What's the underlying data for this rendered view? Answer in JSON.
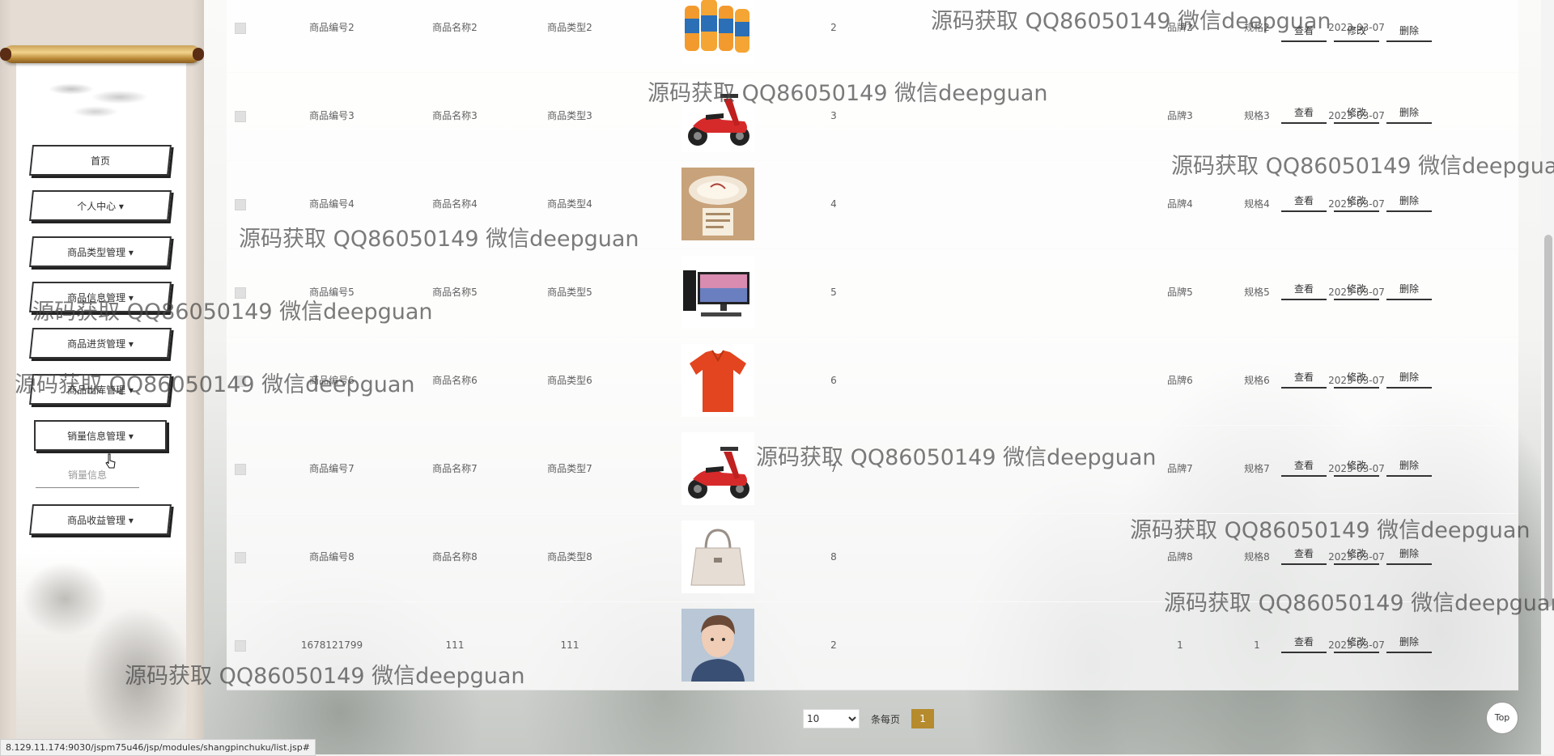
{
  "sidebar": {
    "menu": [
      {
        "label": "首页"
      },
      {
        "label": "个人中心 ▾"
      },
      {
        "label": "商品类型管理 ▾"
      },
      {
        "label": "商品信息管理 ▾"
      },
      {
        "label": "商品进货管理 ▾"
      },
      {
        "label": "商品出库管理 ▾"
      },
      {
        "label": "销量信息管理 ▾"
      },
      {
        "label": "商品收益管理 ▾"
      }
    ],
    "submenu": {
      "label": "销量信息"
    }
  },
  "table": {
    "actions": {
      "view": "查看",
      "edit": "修改",
      "delete": "删除"
    },
    "rows": [
      {
        "code": "商品编号2",
        "name": "商品名称2",
        "type": "商品类型2",
        "image": "juice-bottles",
        "qty": "2",
        "brand": "品牌2",
        "spec": "规格2",
        "date": "2023-03-07"
      },
      {
        "code": "商品编号3",
        "name": "商品名称3",
        "type": "商品类型3",
        "image": "red-scooter",
        "qty": "3",
        "brand": "品牌3",
        "spec": "规格3",
        "date": "2023-03-07"
      },
      {
        "code": "商品编号4",
        "name": "商品名称4",
        "type": "商品类型4",
        "image": "ceiling-lamp",
        "qty": "4",
        "brand": "品牌4",
        "spec": "规格4",
        "date": "2023-03-07"
      },
      {
        "code": "商品编号5",
        "name": "商品名称5",
        "type": "商品类型5",
        "image": "desktop-computer",
        "qty": "5",
        "brand": "品牌5",
        "spec": "规格5",
        "date": "2023-03-07"
      },
      {
        "code": "商品编号6",
        "name": "商品名称6",
        "type": "商品类型6",
        "image": "red-polo-shirt",
        "qty": "6",
        "brand": "品牌6",
        "spec": "规格6",
        "date": "2023-03-07"
      },
      {
        "code": "商品编号7",
        "name": "商品名称7",
        "type": "商品类型7",
        "image": "red-scooter",
        "qty": "7",
        "brand": "品牌7",
        "spec": "规格7",
        "date": "2023-03-07"
      },
      {
        "code": "商品编号8",
        "name": "商品名称8",
        "type": "商品类型8",
        "image": "handbag",
        "qty": "8",
        "brand": "品牌8",
        "spec": "规格8",
        "date": "2023-03-07"
      },
      {
        "code": "1678121799",
        "name": "111",
        "type": "111",
        "image": "portrait-photo",
        "qty": "2",
        "brand": "1",
        "spec": "1",
        "date": "2023-03-07"
      }
    ]
  },
  "pagination": {
    "page_size": "10",
    "page_size_options": [
      "10"
    ],
    "per_page_label": "条每页",
    "current_page": "1"
  },
  "top_button": "Top",
  "status_url": "8.129.11.174:9030/jspm75u46/jsp/modules/shangpinchuku/list.jsp#",
  "watermark": "源码获取 QQ86050149 微信deepguan",
  "colors": {
    "accent": "#b68b2d",
    "text": "#606060"
  }
}
